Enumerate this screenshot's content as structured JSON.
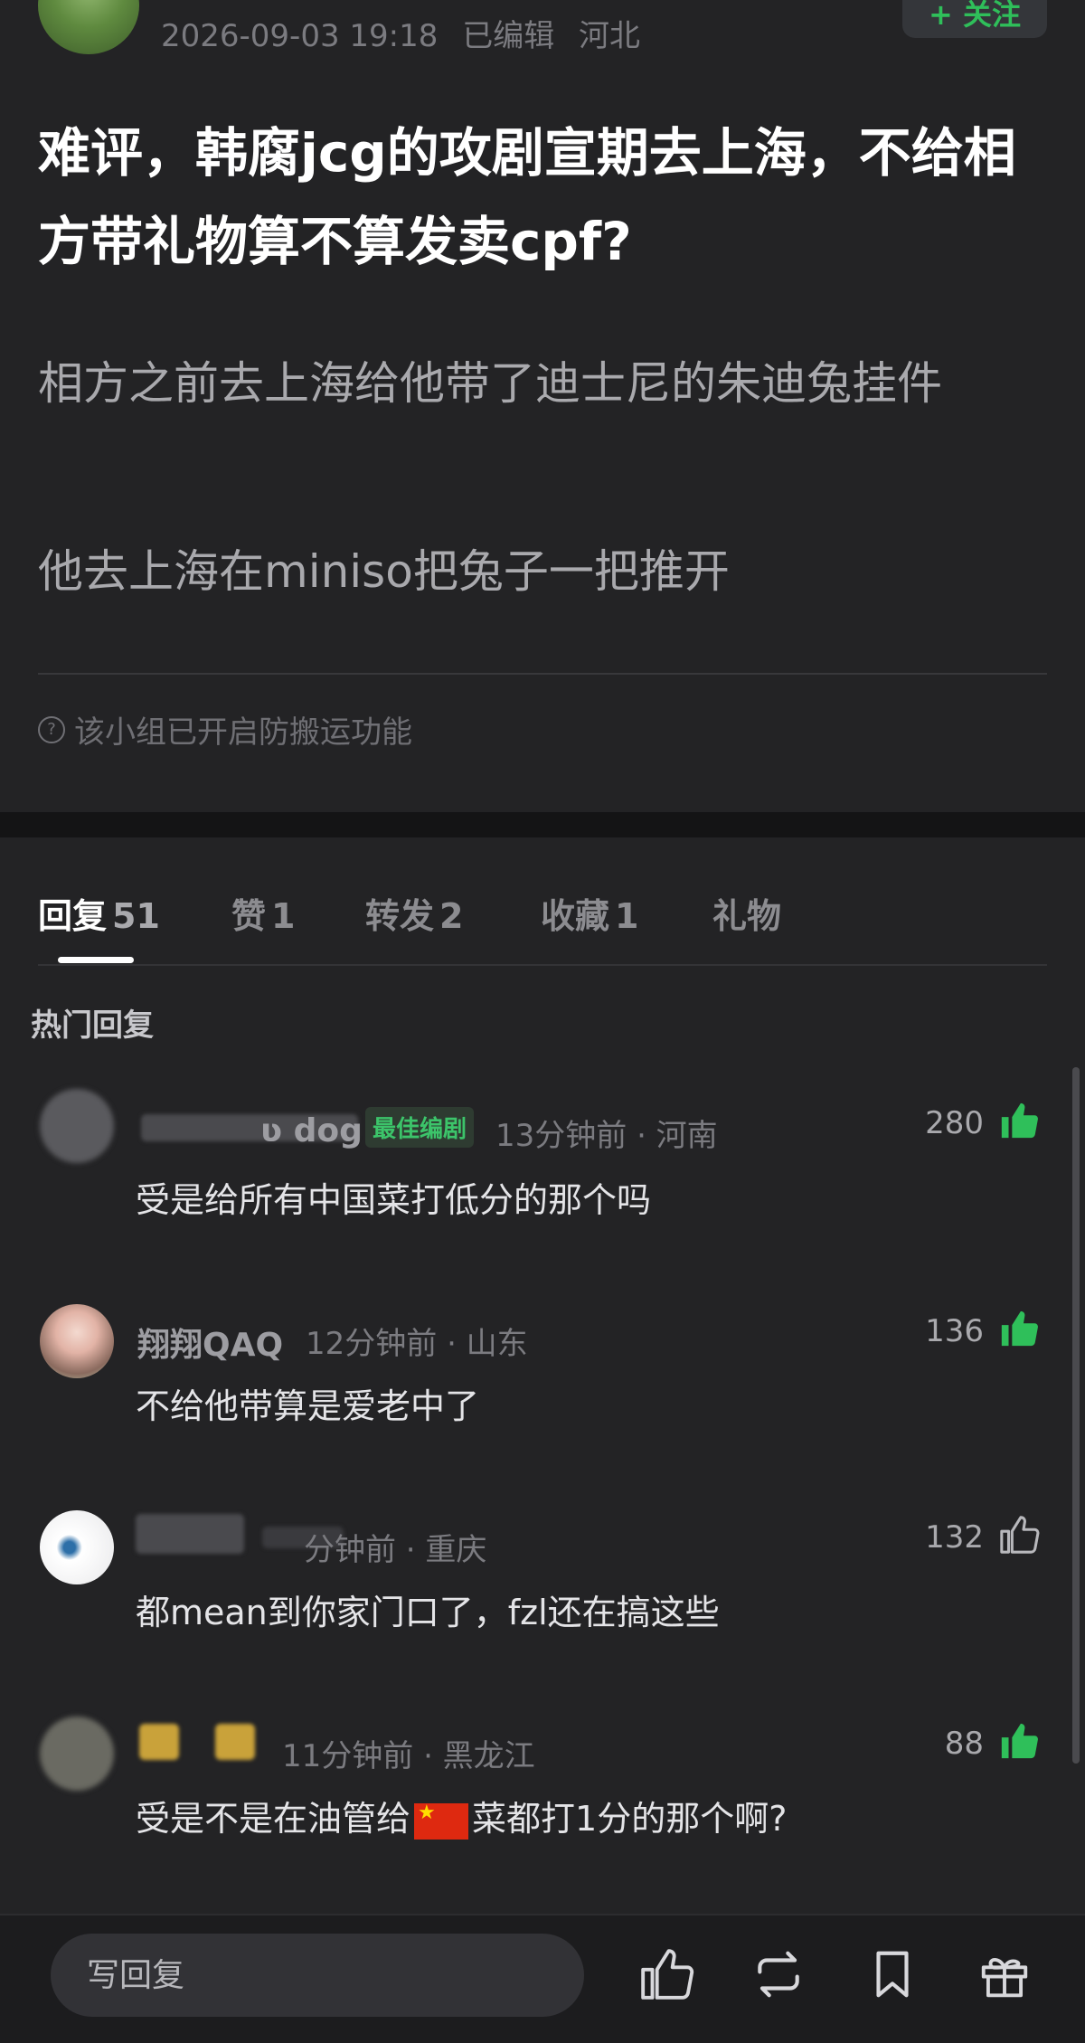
{
  "post": {
    "meta": {
      "datetime": "2026-09-03 19:18",
      "edited": "已编辑",
      "location": "河北"
    },
    "follow_label": "+ 关注",
    "title": "难评，韩腐jcg的攻剧宣期去上海，不给相方带礼物算不算发卖cpf?",
    "body": [
      "相方之前去上海给他带了迪士尼的朱迪兔挂件",
      "他去上海在miniso把兔子一把推开"
    ],
    "notice": "该小组已开启防搬运功能"
  },
  "tabs": [
    {
      "label": "回复",
      "count": "51"
    },
    {
      "label": "赞",
      "count": "1"
    },
    {
      "label": "转发",
      "count": "2"
    },
    {
      "label": "收藏",
      "count": "1"
    },
    {
      "label": "礼物",
      "count": ""
    }
  ],
  "hot_replies_label": "热门回复",
  "comments": [
    {
      "name": "ʋ dog",
      "badge": "最佳编剧",
      "time": "13分钟前 · 河南",
      "text": "受是给所有中国菜打低分的那个吗",
      "likes": "280",
      "liked": true
    },
    {
      "name": "翔翔QAQ",
      "badge": "",
      "time": "12分钟前 · 山东",
      "text": "不给他带算是爱老中了",
      "likes": "136",
      "liked": true
    },
    {
      "name": "",
      "badge": "",
      "time": "分钟前 · 重庆",
      "text": "都mean到你家门口了，fzl还在搞这些",
      "likes": "132",
      "liked": false
    },
    {
      "name": "",
      "badge": "",
      "time": "11分钟前 · 黑龙江",
      "text_before_flag": "受是不是在油管给",
      "text_after_flag": "菜都打1分的那个啊?",
      "likes": "88",
      "liked": true
    }
  ],
  "bottom_bar": {
    "reply_placeholder": "写回复"
  },
  "colors": {
    "background": "#232325",
    "accent_green": "#2fbf5a",
    "like_green": "#2fbf5a"
  }
}
